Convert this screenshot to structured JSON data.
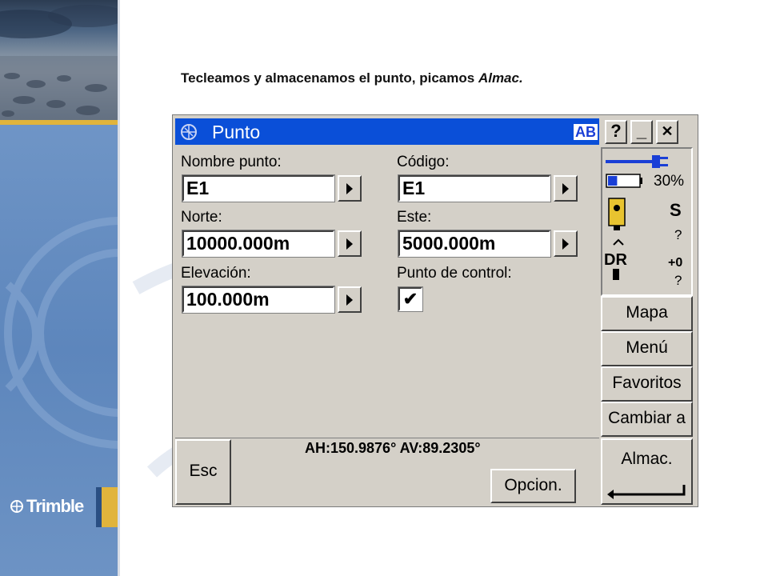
{
  "caption": {
    "text": "Tecleamos y almacenamos el punto, picamos ",
    "emph": "Almac."
  },
  "brand": {
    "logo_text": "Trimble"
  },
  "window": {
    "title": "Punto",
    "input_mode": "AB",
    "help_label": "?",
    "minimize_label": "_",
    "close_label": "✕"
  },
  "form": {
    "nombre": {
      "label": "Nombre punto:",
      "value": "E1"
    },
    "codigo": {
      "label": "Código:",
      "value": "E1"
    },
    "norte": {
      "label": "Norte:",
      "value": "10000.000m"
    },
    "este": {
      "label": "Este:",
      "value": "5000.000m"
    },
    "elevacion": {
      "label": "Elevación:",
      "value": "100.000m"
    },
    "control": {
      "label": "Punto de control:",
      "checked": true,
      "mark": "✔"
    }
  },
  "status": {
    "battery_percent": 30,
    "battery_label": "30%",
    "instrument_code": "S",
    "instrument_status": "?",
    "dr_label": "DR",
    "dr_offset": "+0",
    "dr_status": "?"
  },
  "side_buttons": [
    "Mapa",
    "Menú",
    "Favoritos",
    "Cambiar a"
  ],
  "bottom": {
    "esc_label": "Esc",
    "readout": "AH:150.9876°  AV:89.2305°",
    "opcion_label": "Opcion.",
    "almac_label": "Almac."
  },
  "colors": {
    "titlebar": "#0a4fd8",
    "chrome": "#d4d0c8",
    "slide_band": "#5f88bd",
    "accent_gold": "#e1b43c"
  }
}
